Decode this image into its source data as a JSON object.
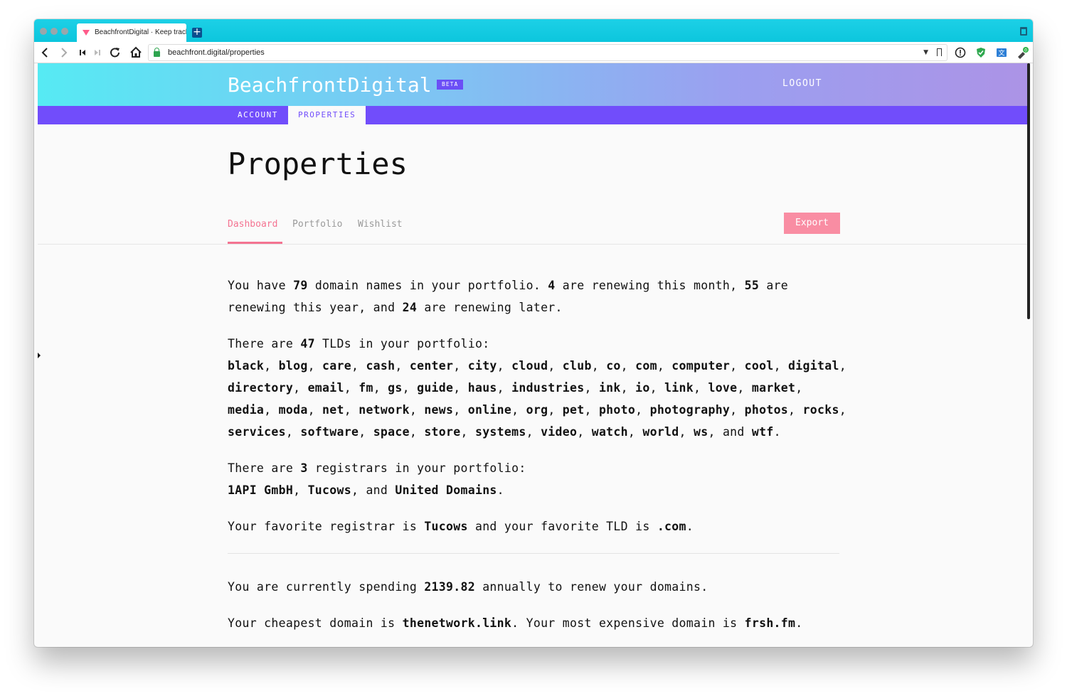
{
  "browser": {
    "tab_title": "BeachfrontDigital · Keep track of your domains",
    "new_tab_symbol": "+",
    "url": "beachfront.digital/properties",
    "extension_badge": "0",
    "icons": [
      "back-icon",
      "forward-icon",
      "first-icon",
      "last-icon",
      "reload-icon",
      "home-icon",
      "lock-icon",
      "bookmark-icon",
      "info-icon",
      "shield-icon",
      "translate-icon",
      "extension-icon",
      "trash-icon"
    ]
  },
  "header": {
    "brand": "BeachfrontDigital",
    "beta_badge": "BETA",
    "logout_label": "LOGOUT"
  },
  "nav": {
    "tabs": [
      {
        "label": "ACCOUNT",
        "active": false
      },
      {
        "label": "PROPERTIES",
        "active": true
      }
    ]
  },
  "main": {
    "title": "Properties",
    "subnav": [
      {
        "label": "Dashboard",
        "active": true
      },
      {
        "label": "Portfolio",
        "active": false
      },
      {
        "label": "Wishlist",
        "active": false
      }
    ],
    "export_label": "Export"
  },
  "summary": {
    "domain_count": "79",
    "renewing_this_month": "4",
    "renewing_this_year": "55",
    "renewing_later": "24",
    "tld_count": "47",
    "tlds": [
      "black",
      "blog",
      "care",
      "cash",
      "center",
      "city",
      "cloud",
      "club",
      "co",
      "com",
      "computer",
      "cool",
      "digital",
      "directory",
      "email",
      "fm",
      "gs",
      "guide",
      "haus",
      "industries",
      "ink",
      "io",
      "link",
      "love",
      "market",
      "media",
      "moda",
      "net",
      "network",
      "news",
      "online",
      "org",
      "pet",
      "photo",
      "photography",
      "photos",
      "rocks",
      "services",
      "software",
      "space",
      "store",
      "systems",
      "video",
      "watch",
      "world",
      "ws",
      "wtf"
    ],
    "registrar_count": "3",
    "registrars": [
      "1API GmbH",
      "Tucows",
      "United Domains"
    ],
    "favorite_registrar": "Tucows",
    "favorite_tld": ".com",
    "annual_spend": "2139.82",
    "cheapest_domain": "thenetwork.link",
    "most_expensive_domain": "frsh.fm"
  },
  "text": {
    "you_have": "You have",
    "domain_names_in_portfolio": "domain names in your portfolio.",
    "are_renewing_this_month": "are renewing this month,",
    "are_renewing_this_year_and": "are renewing this year, and",
    "are_renewing_later": "are renewing later.",
    "there_are": "There are",
    "tlds_in_portfolio": "TLDs in your portfolio:",
    "registrars_in_portfolio": "registrars in your portfolio:",
    "and": "and",
    "favorite_registrar_is": "Your favorite registrar is",
    "and_favorite_tld_is": "and your favorite TLD is",
    "currently_spending": "You are currently spending",
    "annually_to_renew": "annually to renew your domains.",
    "cheapest_domain_is": "Your cheapest domain is",
    "most_expensive_domain_is": "Your most expensive domain is"
  },
  "colors": {
    "brand_purple": "#714dfb",
    "accent_pink": "#f47391",
    "export_pink": "#f98da3",
    "browser_chrome": "#0cc6dd"
  }
}
